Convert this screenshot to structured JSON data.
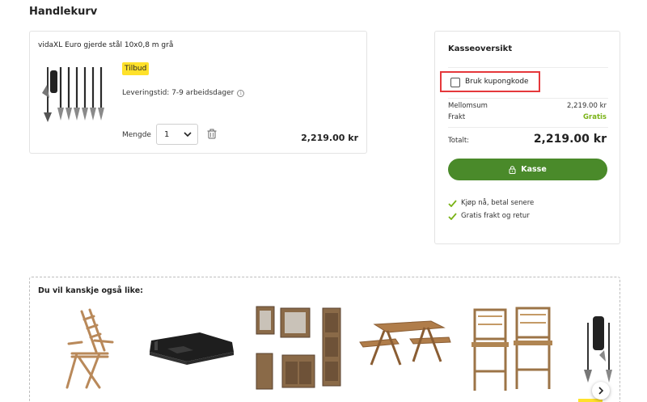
{
  "page": {
    "title": "Handlekurv"
  },
  "cart": {
    "product_name": "vidaXL Euro gjerde stål 10x0,8 m grå",
    "badge": "Tilbud",
    "delivery": "Leveringstid: 7-9 arbeidsdager",
    "quantity_label": "Mengde",
    "quantity_value": "1",
    "line_price": "2,219.00 kr"
  },
  "summary": {
    "title": "Kasseoversikt",
    "coupon_label": "Bruk kupongkode",
    "subtotal_label": "Mellomsum",
    "subtotal_value": "2,219.00 kr",
    "shipping_label": "Frakt",
    "shipping_value": "Gratis",
    "total_label": "Totalt:",
    "total_value": "2,219.00 kr",
    "checkout_label": "Kasse",
    "perks": [
      "Kjøp nå, betal senere",
      "Gratis frakt og retur"
    ]
  },
  "recommendations": {
    "title": "Du vil kanskje også like:"
  },
  "colors": {
    "accent_green": "#4a8a2a",
    "free_green": "#7ab317",
    "badge_yellow": "#ffe12b",
    "highlight_red": "#e5383b"
  }
}
